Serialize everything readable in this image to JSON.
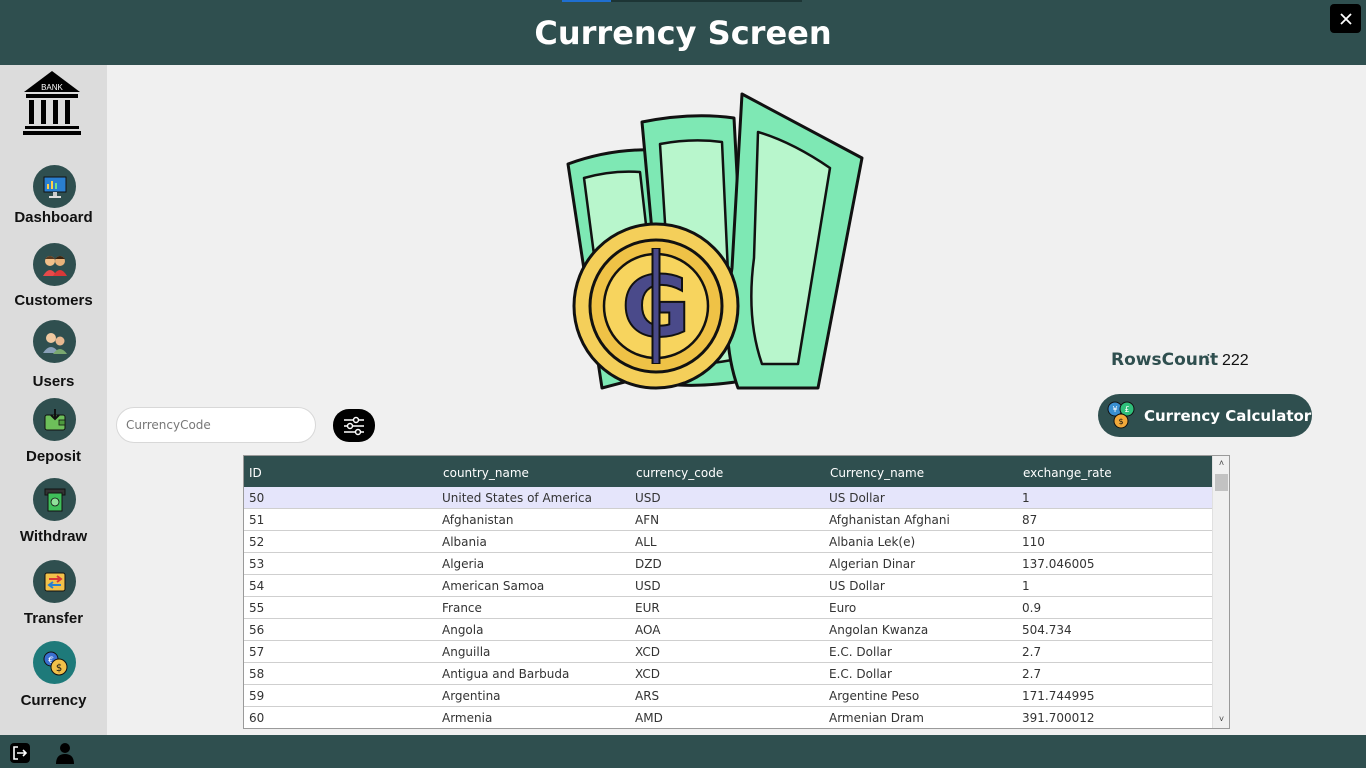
{
  "header": {
    "title": "Currency Screen"
  },
  "sidebar": {
    "logo_text": "BANK",
    "items": [
      {
        "label": "Dashboard"
      },
      {
        "label": "Customers"
      },
      {
        "label": "Users"
      },
      {
        "label": "Deposit"
      },
      {
        "label": "Withdraw"
      },
      {
        "label": "Transfer"
      },
      {
        "label": "Currency"
      }
    ]
  },
  "search": {
    "placeholder": "CurrencyCode",
    "value": ""
  },
  "rows_count": {
    "label": "RowsCount",
    "separator": ":",
    "value": "222"
  },
  "calc_button": {
    "label": "Currency Calculator"
  },
  "grid": {
    "columns": [
      "ID",
      "country_name",
      "currency_code",
      "Currency_name",
      "exchange_rate"
    ],
    "rows": [
      [
        "50",
        "United States of America",
        "USD",
        "US Dollar",
        "1"
      ],
      [
        "51",
        "Afghanistan",
        "AFN",
        "Afghanistan Afghani",
        "87"
      ],
      [
        "52",
        "Albania",
        "ALL",
        "Albania Lek(e)",
        "110"
      ],
      [
        "53",
        "Algeria",
        "DZD",
        "Algerian Dinar",
        "137.046005"
      ],
      [
        "54",
        "American Samoa",
        "USD",
        "US Dollar",
        "1"
      ],
      [
        "55",
        "France",
        "EUR",
        "Euro",
        "0.9"
      ],
      [
        "56",
        "Angola",
        "AOA",
        "Angolan Kwanza",
        "504.734"
      ],
      [
        "57",
        "Anguilla",
        "XCD",
        "E.C. Dollar",
        "2.7"
      ],
      [
        "58",
        "Antigua and Barbuda",
        "XCD",
        "E.C. Dollar",
        "2.7"
      ],
      [
        "59",
        "Argentina",
        "ARS",
        "Argentine Peso",
        "171.744995"
      ],
      [
        "60",
        "Armenia",
        "AMD",
        "Armenian Dram",
        "391.700012"
      ]
    ],
    "selected_row": 0
  },
  "colors": {
    "primary": "#2f4f4f",
    "sidebar": "#dcdcdc",
    "background": "#f0f0f0",
    "selected_row": "#e5e5fb"
  },
  "icons": {
    "close": "close-icon",
    "logo": "bank-logo-icon",
    "filter": "filter-sliders-icon",
    "calc": "currency-exchange-icon",
    "logout": "logout-icon",
    "user": "user-icon"
  }
}
